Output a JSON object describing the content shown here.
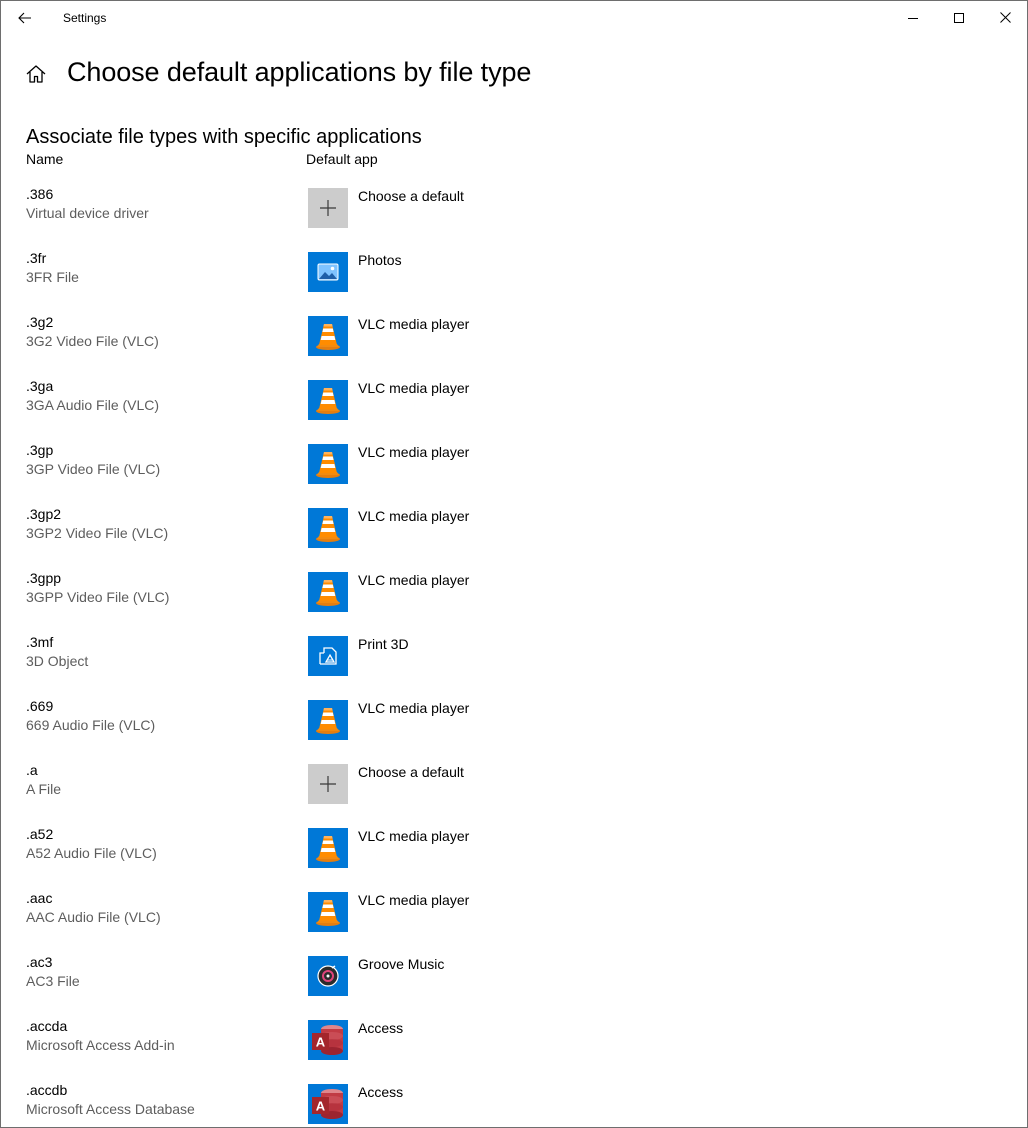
{
  "window": {
    "title": "Settings",
    "back_icon": "back-arrow-icon",
    "minimize_icon": "minimize-icon",
    "maximize_icon": "maximize-icon",
    "close_icon": "close-icon"
  },
  "header": {
    "home_icon": "home-icon",
    "page_title": "Choose default applications by file type"
  },
  "section": {
    "title": "Associate file types with specific applications",
    "col_name": "Name",
    "col_app": "Default app"
  },
  "colors": {
    "tile_blue": "#0078d7",
    "tile_gray": "#cccccc",
    "description_gray": "#5d5d5d"
  },
  "rows": [
    {
      "ext": ".386",
      "desc": "Virtual device driver",
      "app": "Choose a default",
      "icon": "plus-icon"
    },
    {
      "ext": ".3fr",
      "desc": "3FR File",
      "app": "Photos",
      "icon": "photos-icon"
    },
    {
      "ext": ".3g2",
      "desc": "3G2 Video File (VLC)",
      "app": "VLC media player",
      "icon": "vlc-icon"
    },
    {
      "ext": ".3ga",
      "desc": "3GA Audio File (VLC)",
      "app": "VLC media player",
      "icon": "vlc-icon"
    },
    {
      "ext": ".3gp",
      "desc": "3GP Video File (VLC)",
      "app": "VLC media player",
      "icon": "vlc-icon"
    },
    {
      "ext": ".3gp2",
      "desc": "3GP2 Video File (VLC)",
      "app": "VLC media player",
      "icon": "vlc-icon"
    },
    {
      "ext": ".3gpp",
      "desc": "3GPP Video File (VLC)",
      "app": "VLC media player",
      "icon": "vlc-icon"
    },
    {
      "ext": ".3mf",
      "desc": "3D Object",
      "app": "Print 3D",
      "icon": "print3d-icon"
    },
    {
      "ext": ".669",
      "desc": "669 Audio File (VLC)",
      "app": "VLC media player",
      "icon": "vlc-icon"
    },
    {
      "ext": ".a",
      "desc": "A File",
      "app": "Choose a default",
      "icon": "plus-icon"
    },
    {
      "ext": ".a52",
      "desc": "A52 Audio File (VLC)",
      "app": "VLC media player",
      "icon": "vlc-icon"
    },
    {
      "ext": ".aac",
      "desc": "AAC Audio File (VLC)",
      "app": "VLC media player",
      "icon": "vlc-icon"
    },
    {
      "ext": ".ac3",
      "desc": "AC3 File",
      "app": "Groove Music",
      "icon": "groove-icon"
    },
    {
      "ext": ".accda",
      "desc": "Microsoft Access Add-in",
      "app": "Access",
      "icon": "access-icon"
    },
    {
      "ext": ".accdb",
      "desc": "Microsoft Access Database",
      "app": "Access",
      "icon": "access-icon"
    }
  ]
}
